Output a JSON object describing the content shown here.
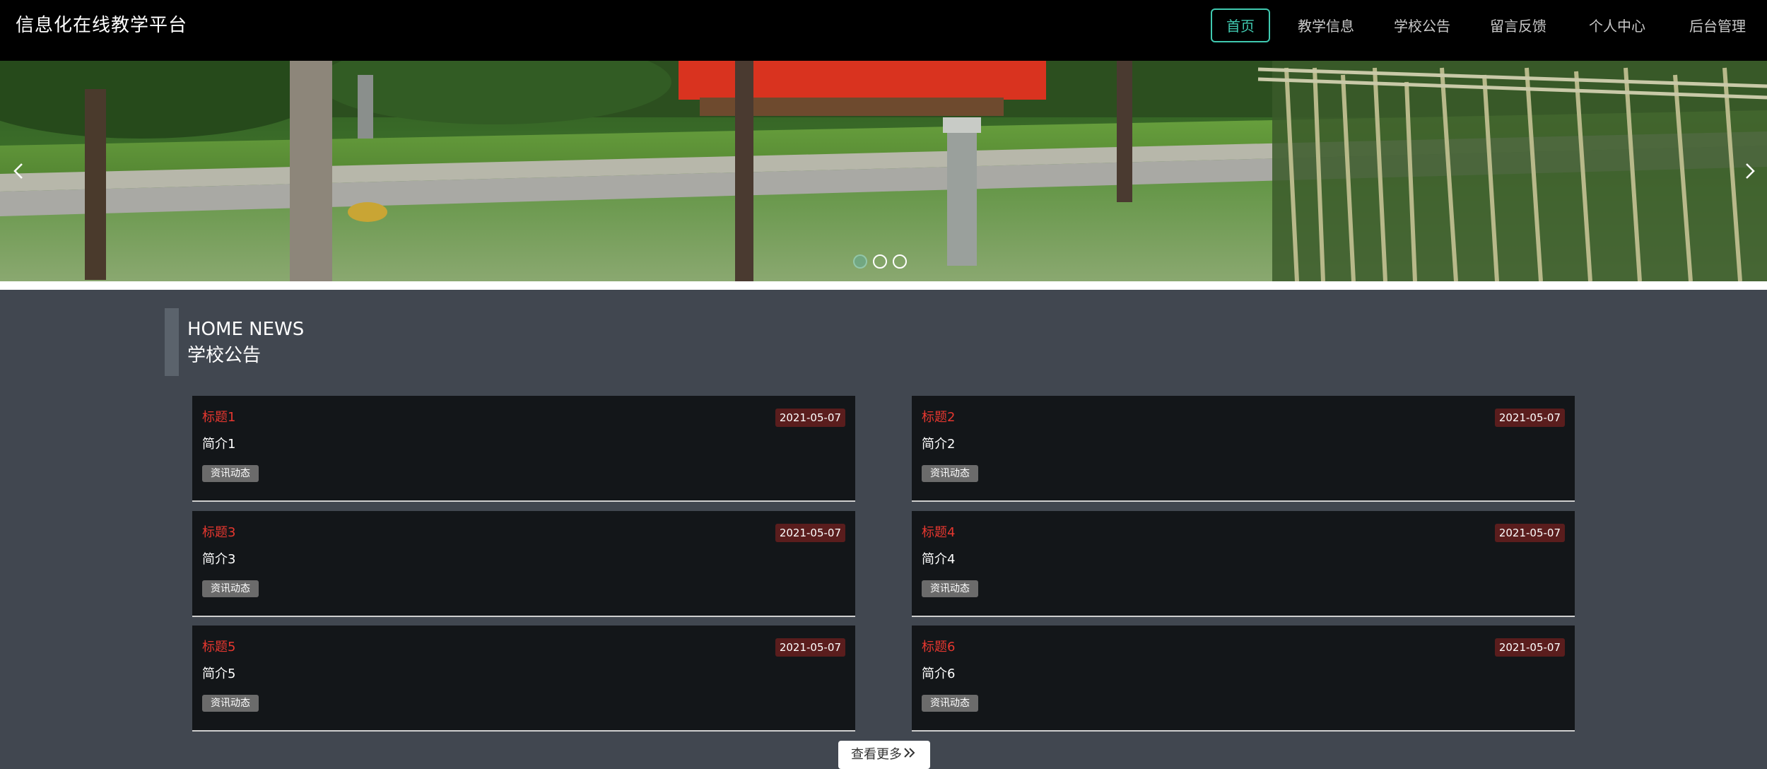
{
  "header": {
    "brand": "信息化在线教学平台",
    "nav": [
      {
        "label": "首页",
        "active": true
      },
      {
        "label": "教学信息",
        "active": false
      },
      {
        "label": "学校公告",
        "active": false
      },
      {
        "label": "留言反馈",
        "active": false
      },
      {
        "label": "个人中心",
        "active": false
      },
      {
        "label": "后台管理",
        "active": false
      }
    ]
  },
  "carousel": {
    "prev_icon": "chevron-left-icon",
    "next_icon": "chevron-right-icon",
    "slide_count": 3,
    "active_index": 0
  },
  "news": {
    "title_en": "HOME NEWS",
    "title_cn": "学校公告",
    "items": [
      {
        "title": "标题1",
        "date": "2021-05-07",
        "desc": "简介1",
        "tag": "资讯动态"
      },
      {
        "title": "标题2",
        "date": "2021-05-07",
        "desc": "简介2",
        "tag": "资讯动态"
      },
      {
        "title": "标题3",
        "date": "2021-05-07",
        "desc": "简介3",
        "tag": "资讯动态"
      },
      {
        "title": "标题4",
        "date": "2021-05-07",
        "desc": "简介4",
        "tag": "资讯动态"
      },
      {
        "title": "标题5",
        "date": "2021-05-07",
        "desc": "简介5",
        "tag": "资讯动态"
      },
      {
        "title": "标题6",
        "date": "2021-05-07",
        "desc": "简介6",
        "tag": "资讯动态"
      }
    ],
    "more_label": "查看更多",
    "more_icon": "double-chevron-right-icon"
  },
  "colors": {
    "accent": "#40c9b0",
    "title_red": "#e5372f",
    "section_bg": "#414750",
    "card_bg": "#131619",
    "header_bg": "#000000"
  }
}
